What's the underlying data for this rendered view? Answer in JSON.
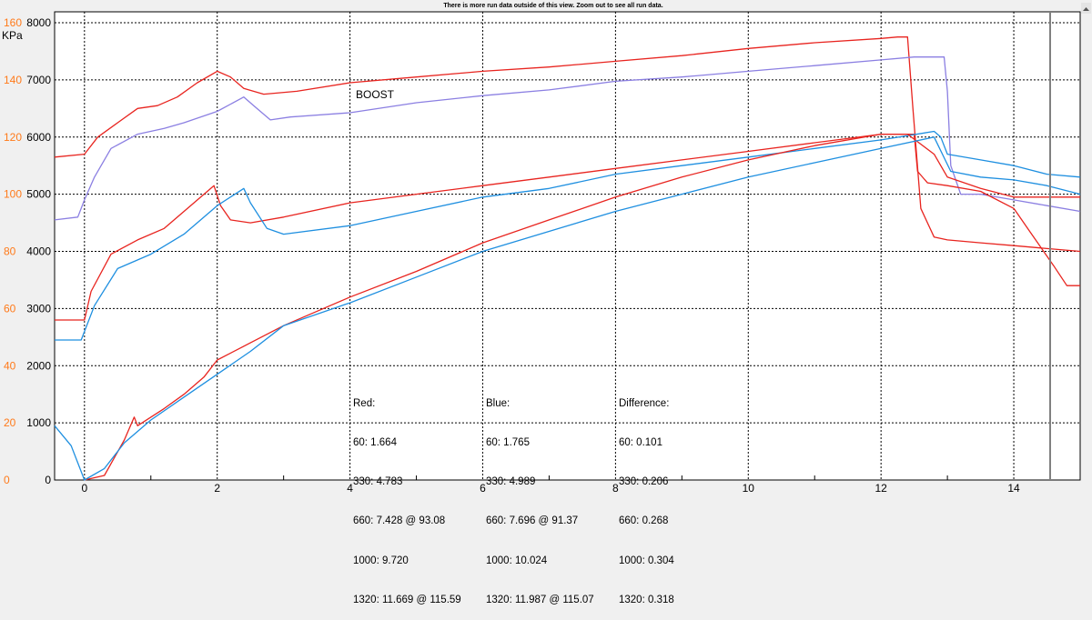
{
  "window": {
    "notice": "There is more run data outside of this view.  Zoom out to see all run data."
  },
  "colors": {
    "red": "#e8241f",
    "blue": "#1e8fe0",
    "purple": "#8b7fe2",
    "left_axis": "#ff7a1a",
    "grid": "#000000"
  },
  "chart_data": {
    "type": "line",
    "title": "",
    "xlabel": "",
    "ylabel": "KPa",
    "xlim": [
      -0.45,
      15.0
    ],
    "x_ticks": [
      "0",
      "2",
      "4",
      "6",
      "8",
      "10",
      "12",
      "14"
    ],
    "y_right": {
      "label": "",
      "range": [
        0,
        8000
      ],
      "ticks": [
        "0",
        "1000",
        "2000",
        "3000",
        "4000",
        "5000",
        "6000",
        "7000",
        "8000"
      ]
    },
    "y_left": {
      "label": "KPa",
      "range": [
        0,
        160
      ],
      "ticks": [
        "0",
        "20",
        "40",
        "60",
        "80",
        "100",
        "120",
        "140",
        "160"
      ]
    },
    "grid": true,
    "annotation": "BOOST",
    "series": [
      {
        "color": "red",
        "axis": "left",
        "points": [
          [
            -0.45,
            113
          ],
          [
            0,
            114
          ],
          [
            0.2,
            120
          ],
          [
            0.5,
            125
          ],
          [
            0.8,
            130
          ],
          [
            1.1,
            131
          ],
          [
            1.4,
            134
          ],
          [
            1.7,
            139
          ],
          [
            2.0,
            143
          ],
          [
            2.2,
            141
          ],
          [
            2.4,
            137
          ],
          [
            2.7,
            135
          ],
          [
            3.2,
            136
          ],
          [
            4,
            139
          ],
          [
            5,
            141
          ],
          [
            6,
            143
          ],
          [
            7,
            144.5
          ],
          [
            8,
            146.5
          ],
          [
            9,
            148.5
          ],
          [
            10,
            151
          ],
          [
            11,
            153
          ],
          [
            12,
            154.5
          ],
          [
            12.25,
            155
          ],
          [
            12.4,
            155
          ],
          [
            12.48,
            130
          ],
          [
            12.6,
            95
          ],
          [
            12.8,
            85
          ],
          [
            13,
            84
          ],
          [
            13.5,
            83
          ],
          [
            14,
            82
          ],
          [
            14.5,
            81
          ],
          [
            15,
            80
          ]
        ]
      },
      {
        "color": "purple",
        "axis": "left",
        "points": [
          [
            -0.45,
            91
          ],
          [
            -0.1,
            92
          ],
          [
            0,
            98
          ],
          [
            0.15,
            106
          ],
          [
            0.4,
            116
          ],
          [
            0.8,
            121
          ],
          [
            1.2,
            123
          ],
          [
            1.5,
            125
          ],
          [
            2.0,
            129
          ],
          [
            2.4,
            134
          ],
          [
            2.55,
            131
          ],
          [
            2.8,
            126
          ],
          [
            3.1,
            127
          ],
          [
            4,
            128.5
          ],
          [
            5,
            132
          ],
          [
            6,
            134.5
          ],
          [
            7,
            136.5
          ],
          [
            8,
            139.5
          ],
          [
            9,
            141
          ],
          [
            10,
            143
          ],
          [
            11,
            145
          ],
          [
            12,
            147
          ],
          [
            12.5,
            148
          ],
          [
            12.95,
            148
          ],
          [
            13.0,
            136
          ],
          [
            13.05,
            110
          ],
          [
            13.2,
            100
          ],
          [
            13.5,
            100
          ],
          [
            14,
            98
          ],
          [
            14.5,
            96
          ],
          [
            15,
            94
          ]
        ]
      },
      {
        "color": "red",
        "axis": "right",
        "points": [
          [
            -0.45,
            2800
          ],
          [
            0,
            2800
          ],
          [
            0.1,
            3300
          ],
          [
            0.4,
            3950
          ],
          [
            0.8,
            4200
          ],
          [
            1.2,
            4400
          ],
          [
            1.6,
            4800
          ],
          [
            1.95,
            5150
          ],
          [
            2.05,
            4800
          ],
          [
            2.2,
            4550
          ],
          [
            2.5,
            4500
          ],
          [
            3,
            4600
          ],
          [
            4,
            4850
          ],
          [
            5,
            5000
          ],
          [
            6,
            5150
          ],
          [
            7,
            5300
          ],
          [
            8,
            5450
          ],
          [
            9,
            5600
          ],
          [
            10,
            5750
          ],
          [
            11,
            5900
          ],
          [
            12,
            6050
          ],
          [
            12.5,
            6050
          ],
          [
            12.55,
            5400
          ],
          [
            12.7,
            5200
          ],
          [
            13,
            5150
          ],
          [
            13.5,
            5050
          ],
          [
            14,
            4750
          ],
          [
            14.3,
            4250
          ],
          [
            14.6,
            3750
          ],
          [
            14.8,
            3400
          ],
          [
            15,
            3400
          ]
        ]
      },
      {
        "color": "blue",
        "axis": "right",
        "points": [
          [
            -0.45,
            2450
          ],
          [
            -0.05,
            2450
          ],
          [
            0.15,
            3050
          ],
          [
            0.5,
            3700
          ],
          [
            1.0,
            3950
          ],
          [
            1.5,
            4300
          ],
          [
            2.0,
            4800
          ],
          [
            2.4,
            5100
          ],
          [
            2.5,
            4850
          ],
          [
            2.75,
            4400
          ],
          [
            3,
            4300
          ],
          [
            4,
            4450
          ],
          [
            5,
            4700
          ],
          [
            6,
            4950
          ],
          [
            7,
            5100
          ],
          [
            8,
            5350
          ],
          [
            9,
            5500
          ],
          [
            10,
            5650
          ],
          [
            11,
            5800
          ],
          [
            12,
            5950
          ],
          [
            12.8,
            6100
          ],
          [
            12.9,
            6000
          ],
          [
            13.0,
            5700
          ],
          [
            13.5,
            5600
          ],
          [
            14,
            5500
          ],
          [
            14.5,
            5350
          ],
          [
            15,
            5300
          ]
        ]
      },
      {
        "color": "red",
        "axis": "right",
        "points": [
          [
            0,
            0
          ],
          [
            0.3,
            80
          ],
          [
            0.6,
            700
          ],
          [
            0.75,
            1100
          ],
          [
            0.8,
            950
          ],
          [
            1.2,
            1250
          ],
          [
            1.5,
            1500
          ],
          [
            1.8,
            1800
          ],
          [
            2.0,
            2100
          ],
          [
            2.5,
            2400
          ],
          [
            3,
            2700
          ],
          [
            4,
            3200
          ],
          [
            5,
            3650
          ],
          [
            6,
            4150
          ],
          [
            7,
            4550
          ],
          [
            8,
            4950
          ],
          [
            9,
            5300
          ],
          [
            10,
            5600
          ],
          [
            11,
            5850
          ],
          [
            12,
            6050
          ],
          [
            12.4,
            6050
          ],
          [
            12.8,
            5700
          ],
          [
            13,
            5300
          ],
          [
            13.5,
            5100
          ],
          [
            14,
            4950
          ],
          [
            14.5,
            4950
          ],
          [
            15,
            4950
          ]
        ]
      },
      {
        "color": "blue",
        "axis": "right",
        "points": [
          [
            -0.45,
            950
          ],
          [
            -0.2,
            600
          ],
          [
            0,
            0
          ],
          [
            0.3,
            200
          ],
          [
            0.6,
            650
          ],
          [
            1.0,
            1050
          ],
          [
            1.5,
            1450
          ],
          [
            2.0,
            1850
          ],
          [
            2.5,
            2250
          ],
          [
            3,
            2700
          ],
          [
            4,
            3100
          ],
          [
            5,
            3550
          ],
          [
            6,
            4000
          ],
          [
            7,
            4350
          ],
          [
            8,
            4700
          ],
          [
            9,
            5000
          ],
          [
            10,
            5300
          ],
          [
            11,
            5550
          ],
          [
            12,
            5800
          ],
          [
            12.8,
            6000
          ],
          [
            13.05,
            5400
          ],
          [
            13.5,
            5300
          ],
          [
            14,
            5250
          ],
          [
            14.5,
            5150
          ],
          [
            15,
            5000
          ]
        ]
      }
    ],
    "stats": [
      {
        "lines": [
          "Red:",
          "60: 1.664",
          "330: 4.783",
          "660: 7.428 @ 93.08",
          "1000: 9.720",
          "1320: 11.669 @ 115.59"
        ]
      },
      {
        "lines": [
          "Blue:",
          "60: 1.765",
          "330: 4.989",
          "660: 7.696 @ 91.37",
          "1000: 10.024",
          "1320: 11.987 @ 115.07"
        ]
      },
      {
        "lines": [
          "Difference:",
          "60: 0.101",
          "330: 0.206",
          "660: 0.268",
          "1000: 0.304",
          "1320: 0.318"
        ]
      }
    ]
  }
}
